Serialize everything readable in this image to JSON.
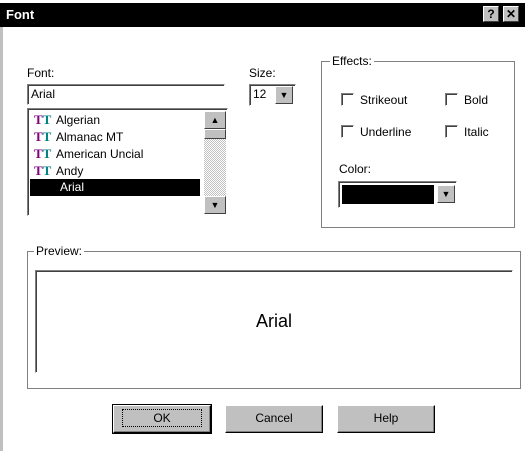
{
  "window": {
    "title": "Font",
    "help_btn": "?",
    "close_btn": "✕"
  },
  "font": {
    "label": "Font:",
    "value": "Arial",
    "items": [
      "Algerian",
      "Almanac MT",
      "American Uncial",
      "Andy",
      "Arial"
    ],
    "selected": "Arial"
  },
  "size": {
    "label": "Size:",
    "value": "12"
  },
  "effects": {
    "title": "Effects:",
    "strikeout": "Strikeout",
    "bold": "Bold",
    "underline": "Underline",
    "italic": "Italic",
    "color_label": "Color:",
    "color_value": "#000000"
  },
  "preview": {
    "title": "Preview:",
    "sample": "Arial"
  },
  "buttons": {
    "ok": "OK",
    "cancel": "Cancel",
    "help": "Help"
  },
  "icons": {
    "truetype": "truetype-icon",
    "scroll_up": "up-arrow-icon",
    "scroll_down": "down-arrow-icon",
    "dropdown": "down-arrow-icon"
  }
}
